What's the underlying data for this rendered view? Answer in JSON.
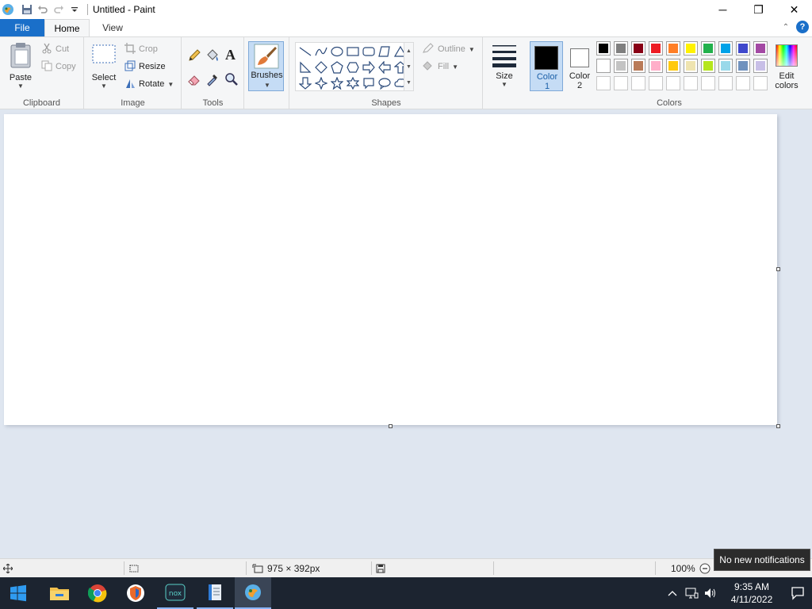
{
  "window": {
    "title": "Untitled - Paint",
    "minimize_glyph": "─",
    "maximize_glyph": "❐",
    "close_glyph": "✕"
  },
  "tabs": {
    "file": "File",
    "home": "Home",
    "view": "View",
    "help_glyph": "?",
    "collapse_glyph": "⌃"
  },
  "clipboard": {
    "paste": "Paste",
    "cut": "Cut",
    "copy": "Copy",
    "label": "Clipboard"
  },
  "image": {
    "select": "Select",
    "crop": "Crop",
    "resize": "Resize",
    "rotate": "Rotate",
    "label": "Image"
  },
  "tools": {
    "label": "Tools",
    "text_glyph": "A"
  },
  "brushes": {
    "label": "Brushes"
  },
  "shapes": {
    "outline": "Outline",
    "fill": "Fill",
    "label": "Shapes"
  },
  "size": {
    "label": "Size"
  },
  "colors": {
    "color1_label": "Color 1",
    "color1_line1": "Color",
    "color1_line2": "1",
    "color2_line1": "Color",
    "color2_line2": "2",
    "edit_line1": "Edit",
    "edit_line2": "colors",
    "label": "Colors",
    "color1_value": "#000000",
    "color2_value": "#ffffff",
    "palette_row1": [
      "#000000",
      "#7f7f7f",
      "#880015",
      "#ed1c24",
      "#ff7f27",
      "#fff200",
      "#22b14c",
      "#00a2e8",
      "#3f48cc",
      "#a349a4"
    ],
    "palette_row2": [
      "#ffffff",
      "#c3c3c3",
      "#b97a57",
      "#ffaec9",
      "#ffc90e",
      "#efe4b0",
      "#b5e61d",
      "#99d9ea",
      "#7092be",
      "#c8bfe7"
    ],
    "palette_row3": [
      "",
      "",
      "",
      "",
      "",
      "",
      "",
      "",
      "",
      ""
    ]
  },
  "status": {
    "canvas_size": "975 × 392px",
    "zoom": "100%"
  },
  "taskbar": {
    "time": "9:35 AM",
    "date": "4/11/2022"
  },
  "tooltip": {
    "text": "No new notifications"
  }
}
